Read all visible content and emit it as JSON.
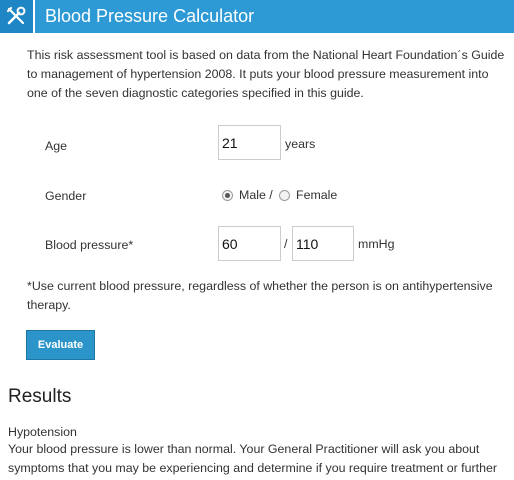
{
  "header": {
    "title": "Blood Pressure Calculator",
    "icon": "tools-icon"
  },
  "intro": "This risk assessment tool is based on data from the National Heart Foundation´s Guide to management of hypertension 2008. It puts your blood pressure measurement into one of the seven diagnostic categories specified in this guide.",
  "form": {
    "age": {
      "label": "Age",
      "value": "21",
      "unit": "years"
    },
    "gender": {
      "label": "Gender",
      "options": [
        "Male /",
        "Female"
      ],
      "selected": "Male"
    },
    "blood_pressure": {
      "label": "Blood pressure*",
      "value_1": "60",
      "separator": "/",
      "value_2": "110",
      "unit": "mmHg"
    },
    "note": "*Use current blood pressure, regardless of whether the person is on antihypertensive therapy.",
    "evaluate_label": "Evaluate"
  },
  "results": {
    "heading": "Results",
    "category": "Hypotension",
    "text": "Your blood pressure is lower than normal. Your General Practitioner will ask you about symptoms that you may be experiencing and determine if you require treatment or further investigation."
  }
}
